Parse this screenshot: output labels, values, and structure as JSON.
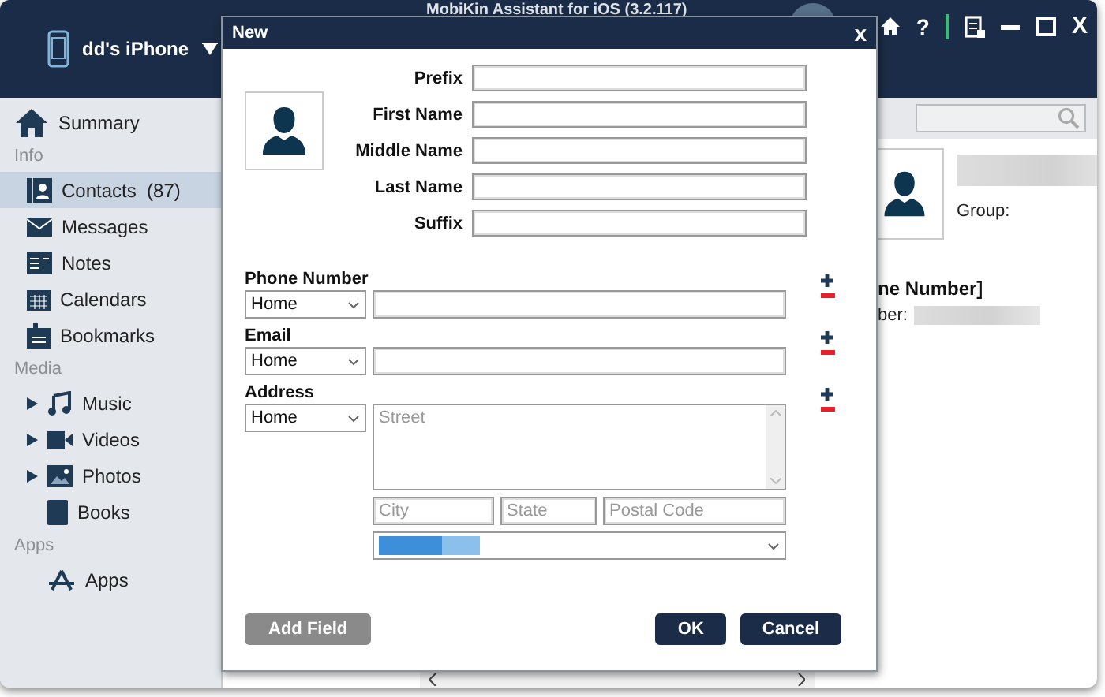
{
  "app": {
    "title": "MobiKin Assistant for iOS (3.2.117)",
    "help_glyph": "?",
    "close_glyph": "X"
  },
  "device": {
    "name": "dd's iPhone"
  },
  "sidebar": {
    "sections": [
      {
        "items": [
          {
            "label": "Summary",
            "selected": false
          }
        ]
      },
      {
        "heading": "Info",
        "items": [
          {
            "label": "Contacts",
            "count": "(87)",
            "selected": true
          },
          {
            "label": "Messages",
            "selected": false
          },
          {
            "label": "Notes",
            "selected": false
          },
          {
            "label": "Calendars",
            "selected": false
          },
          {
            "label": "Bookmarks",
            "selected": false
          }
        ]
      },
      {
        "heading": "Media",
        "items": [
          {
            "label": "Music",
            "expandable": true,
            "selected": false
          },
          {
            "label": "Videos",
            "expandable": true,
            "selected": false
          },
          {
            "label": "Photos",
            "expandable": true,
            "selected": false
          },
          {
            "label": "Books",
            "selected": false
          }
        ]
      },
      {
        "heading": "Apps",
        "items": [
          {
            "label": "Apps",
            "selected": false
          }
        ]
      }
    ]
  },
  "detail": {
    "group_label": "Group:",
    "section_heading": "ne Number]",
    "field_label": "ber:"
  },
  "dialog": {
    "title": "New",
    "close_glyph": "x",
    "name_fields": [
      {
        "label": "Prefix"
      },
      {
        "label": "First Name"
      },
      {
        "label": "Middle Name"
      },
      {
        "label": "Last Name"
      },
      {
        "label": "Suffix"
      }
    ],
    "sections": [
      {
        "heading": "Phone Number",
        "kind": "single",
        "type": "Home"
      },
      {
        "heading": "Email",
        "kind": "single",
        "type": "Home"
      },
      {
        "heading": "Address",
        "kind": "address",
        "type": "Home",
        "street_placeholder": "Street",
        "city_placeholder": "City",
        "state_placeholder": "State",
        "postal_placeholder": "Postal Code"
      }
    ],
    "buttons": [
      {
        "label": "Add Field",
        "kind": "secondary"
      },
      {
        "label": "OK",
        "kind": "primary"
      },
      {
        "label": "Cancel",
        "kind": "primary"
      }
    ]
  }
}
